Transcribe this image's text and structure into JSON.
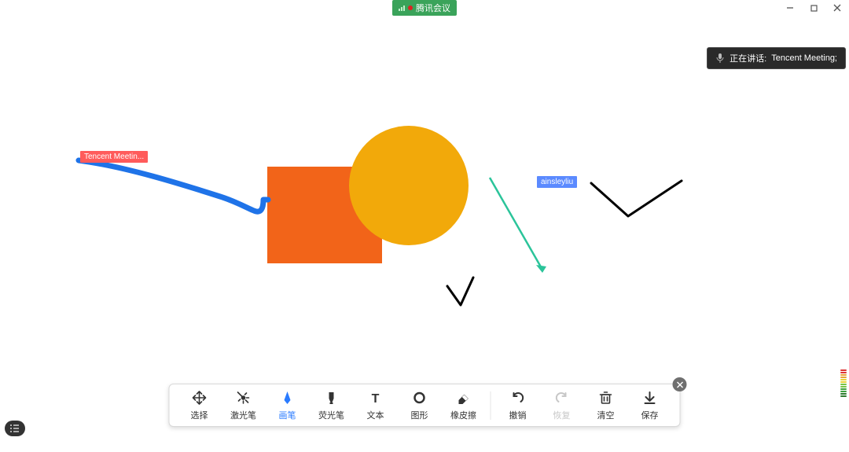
{
  "title": "腾讯会议",
  "speaking": {
    "prefix": "正在讲话:",
    "name": "Tencent Meeting;"
  },
  "user_tags": [
    {
      "id": "tag1",
      "label": "Tencent Meetin..."
    },
    {
      "id": "tag2",
      "label": "ainsleyliu"
    }
  ],
  "toolbar": {
    "select": "选择",
    "laser": "激光笔",
    "pen": "画笔",
    "highlighter": "荧光笔",
    "text": "文本",
    "shape": "图形",
    "eraser": "橡皮擦",
    "undo": "撤销",
    "redo": "恢复",
    "clear": "清空",
    "save": "保存"
  },
  "colors": {
    "accent": "#2a7bff",
    "orange_rect": "#f26419",
    "orange_circle": "#f2a90a",
    "teal_arrow": "#2bc49a",
    "blue_stroke": "#1f73e8"
  }
}
